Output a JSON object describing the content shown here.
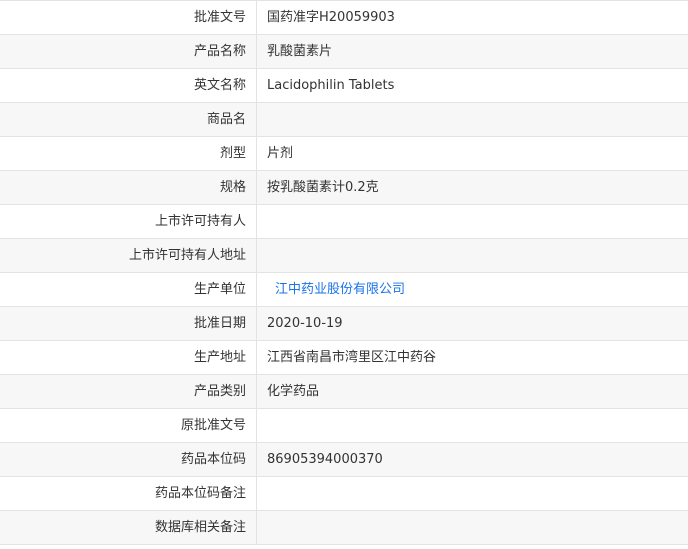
{
  "rows": [
    {
      "label": "批准文号",
      "value": "国药准字H20059903"
    },
    {
      "label": "产品名称",
      "value": "乳酸菌素片"
    },
    {
      "label": "英文名称",
      "value": "Lacidophilin Tablets"
    },
    {
      "label": "商品名",
      "value": ""
    },
    {
      "label": "剂型",
      "value": "片剂"
    },
    {
      "label": "规格",
      "value": "按乳酸菌素计0.2克"
    },
    {
      "label": "上市许可持有人",
      "value": ""
    },
    {
      "label": "上市许可持有人地址",
      "value": ""
    },
    {
      "label": "生产单位",
      "value": "江中药业股份有限公司"
    },
    {
      "label": "批准日期",
      "value": "2020-10-19"
    },
    {
      "label": "生产地址",
      "value": "江西省南昌市湾里区江中药谷"
    },
    {
      "label": "产品类别",
      "value": "化学药品"
    },
    {
      "label": "原批准文号",
      "value": ""
    },
    {
      "label": "药品本位码",
      "value": "86905394000370"
    },
    {
      "label": "药品本位码备注",
      "value": ""
    },
    {
      "label": "数据库相关备注",
      "value": ""
    }
  ],
  "colors": {
    "link": "#1a73e8",
    "border": "#e3e3e3",
    "alt_row": "#f7f7f7"
  }
}
